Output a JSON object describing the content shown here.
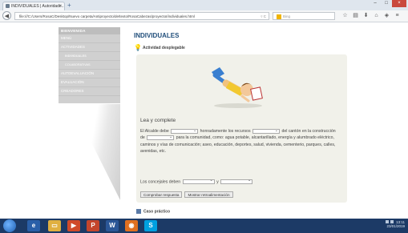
{
  "browser": {
    "tab_title": "INDIVIDUALES | Autoridade...",
    "tab_close": "×",
    "new_tab": "+",
    "win_min": "–",
    "win_max": "□",
    "win_close": "×",
    "back": "◀",
    "url": "file:///C:/Users/RosaC/Desktop/Nuevo carpeta/Antiproyecto/de/texto/RosaCabezas/proyectoI/individuales.html",
    "url_right": "▿ C",
    "search_placeholder": "Bing",
    "icons": [
      "star-icon",
      "bookmarks-icon",
      "download-icon",
      "home-icon",
      "shield-icon",
      "menu-icon"
    ]
  },
  "sidebar": {
    "header": "BIENVENIDA",
    "items": [
      {
        "label": "MENÚ"
      },
      {
        "label": "ACTIVIDADES"
      },
      {
        "label": "INDIVIDUALES"
      },
      {
        "label": "COLABORATIVAS"
      },
      {
        "label": "AUTOEVALUACIÓN"
      },
      {
        "label": "EVALUACIÓN"
      },
      {
        "label": "CREADORES"
      }
    ]
  },
  "main": {
    "title": "INDIVIDUALES",
    "activity_label": "Actividad desplegable",
    "lead": "Lea y complete",
    "para_1": "El Alcalde debe",
    "para_2": "honradamente los recursos",
    "para_3": "del cantón en la construcción de",
    "para_4": "para la comunidad, como: agua potable, alcantarillado, energía y alumbrado eléctrico, caminos y vías de comunicación; aseo, educación, deportes, salud, vivienda, cementerio, parques, calles, avenidas, etc.",
    "conc_1": "Los concejales deben",
    "conc_2": "y",
    "btn_check": "Comprobar respuesta",
    "btn_feedback": "Mostrar retroalimentación",
    "case_label": "Caso práctico"
  },
  "taskbar": {
    "time": "13:11",
    "date": "23/01/2019"
  }
}
